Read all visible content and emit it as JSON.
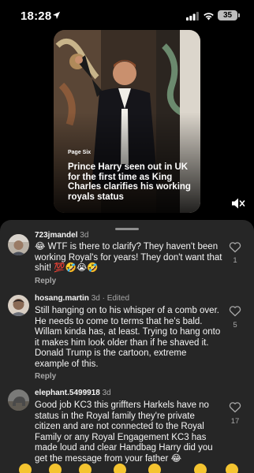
{
  "status": {
    "time": "18:28",
    "battery": "35"
  },
  "post": {
    "source": "Page Six",
    "headline": "Prince Harry seen out in UK for the first time as King Charles clarifies his working royals status"
  },
  "comments": [
    {
      "username": "723jmandel",
      "meta": "3d",
      "text": "😂 WTF is there to clarify? They haven't been working Royal's for years! They don't want that shit! 💯🤣😭🤣",
      "likes": "1",
      "reply": "Reply"
    },
    {
      "username": "hosang.martin",
      "meta": "3d · Edited",
      "text": "Still hanging on to his whisper of a comb over. He needs to come to terms that he's bald. Willam kinda has, at least. Trying to hang onto it makes him look older than if he shaved it. Donald Trump is the cartoon, extreme example of this.",
      "likes": "5",
      "reply": "Reply"
    },
    {
      "username": "elephant.5499918",
      "meta": "3d",
      "text": "Good job KC3 this griffters Harkels have no status in the Royal family they're private citizen and are not connected to the Royal Family or any Royal Engagement KC3 has made loud and clear Handbag Harry did you get the message from your father 😂",
      "likes": "17",
      "reply": ""
    }
  ],
  "colors": {
    "sheet": "#262626",
    "secondary_text": "#a8a8a8",
    "primary_text": "#f5f5f5"
  },
  "icons": [
    "location-arrow-icon",
    "signal-icon",
    "wifi-icon",
    "battery-icon",
    "mute-icon",
    "heart-icon",
    "emoji-icon"
  ]
}
